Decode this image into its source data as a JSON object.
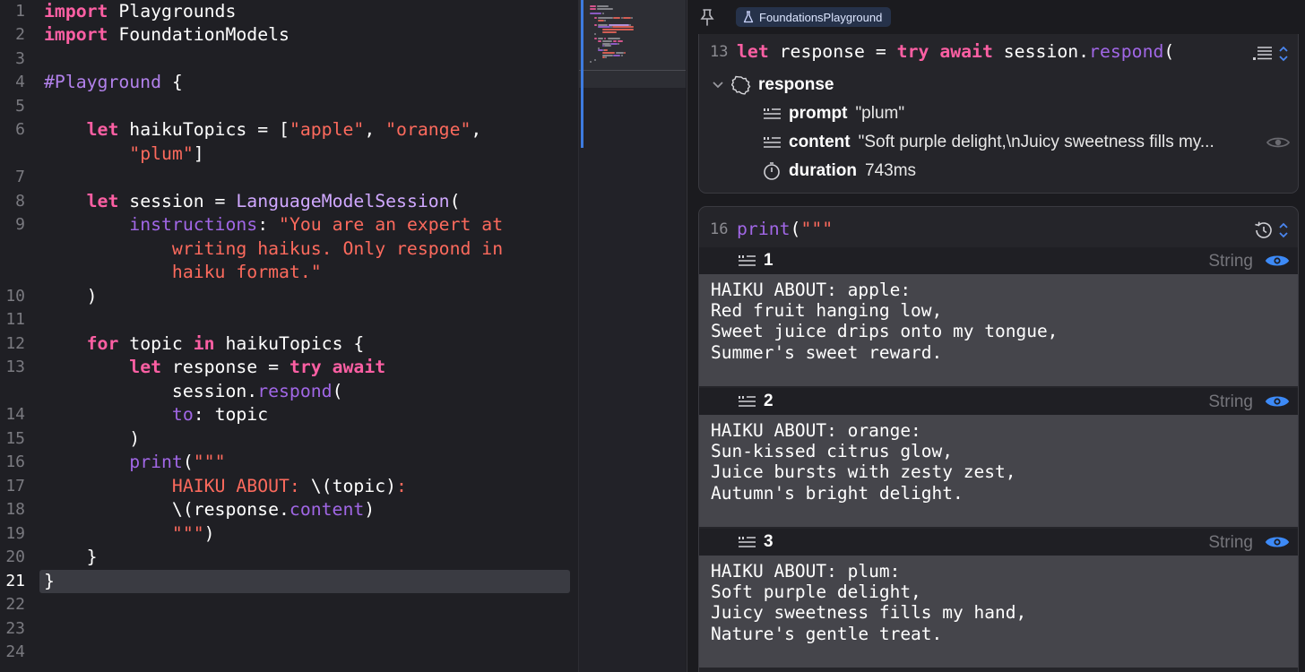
{
  "editor": {
    "lines": [
      {
        "n": "1",
        "tokens": [
          {
            "t": "import",
            "c": "kw"
          },
          {
            "t": " Playgrounds",
            "c": "pl"
          }
        ]
      },
      {
        "n": "2",
        "tokens": [
          {
            "t": "import",
            "c": "kw"
          },
          {
            "t": " FoundationModels",
            "c": "pl"
          }
        ]
      },
      {
        "n": "3",
        "tokens": []
      },
      {
        "n": "4",
        "tokens": [
          {
            "t": "#Playground",
            "c": "mac"
          },
          {
            "t": " {",
            "c": "pl"
          }
        ]
      },
      {
        "n": "5",
        "tokens": []
      },
      {
        "n": "6",
        "tokens": [
          {
            "t": "    ",
            "c": "pl"
          },
          {
            "t": "let",
            "c": "kw"
          },
          {
            "t": " haikuTopics = [",
            "c": "pl"
          },
          {
            "t": "\"apple\"",
            "c": "str"
          },
          {
            "t": ", ",
            "c": "pl"
          },
          {
            "t": "\"orange\"",
            "c": "str"
          },
          {
            "t": ",",
            "c": "pl"
          }
        ]
      },
      {
        "n": "",
        "tokens": [
          {
            "t": "        ",
            "c": "pl"
          },
          {
            "t": "\"plum\"",
            "c": "str"
          },
          {
            "t": "]",
            "c": "pl"
          }
        ]
      },
      {
        "n": "7",
        "tokens": []
      },
      {
        "n": "8",
        "tokens": [
          {
            "t": "    ",
            "c": "pl"
          },
          {
            "t": "let",
            "c": "kw"
          },
          {
            "t": " session = ",
            "c": "pl"
          },
          {
            "t": "LanguageModelSession",
            "c": "type"
          },
          {
            "t": "(",
            "c": "pl"
          }
        ]
      },
      {
        "n": "9",
        "tokens": [
          {
            "t": "        ",
            "c": "pl"
          },
          {
            "t": "instructions",
            "c": "fn"
          },
          {
            "t": ": ",
            "c": "pl"
          },
          {
            "t": "\"You are an expert at",
            "c": "str"
          }
        ]
      },
      {
        "n": "",
        "tokens": [
          {
            "t": "            ",
            "c": "pl"
          },
          {
            "t": "writing haikus. Only respond in",
            "c": "str"
          }
        ]
      },
      {
        "n": "",
        "tokens": [
          {
            "t": "            ",
            "c": "pl"
          },
          {
            "t": "haiku format.\"",
            "c": "str"
          }
        ]
      },
      {
        "n": "10",
        "tokens": [
          {
            "t": "    )",
            "c": "pl"
          }
        ]
      },
      {
        "n": "11",
        "tokens": []
      },
      {
        "n": "12",
        "tokens": [
          {
            "t": "    ",
            "c": "pl"
          },
          {
            "t": "for",
            "c": "kw"
          },
          {
            "t": " topic ",
            "c": "pl"
          },
          {
            "t": "in",
            "c": "kw"
          },
          {
            "t": " haikuTopics {",
            "c": "pl"
          }
        ]
      },
      {
        "n": "13",
        "tokens": [
          {
            "t": "        ",
            "c": "pl"
          },
          {
            "t": "let",
            "c": "kw"
          },
          {
            "t": " response = ",
            "c": "pl"
          },
          {
            "t": "try",
            "c": "kw"
          },
          {
            "t": " ",
            "c": "pl"
          },
          {
            "t": "await",
            "c": "kw"
          }
        ]
      },
      {
        "n": "",
        "tokens": [
          {
            "t": "            session.",
            "c": "pl"
          },
          {
            "t": "respond",
            "c": "fn"
          },
          {
            "t": "(",
            "c": "pl"
          }
        ]
      },
      {
        "n": "14",
        "tokens": [
          {
            "t": "            ",
            "c": "pl"
          },
          {
            "t": "to",
            "c": "fn"
          },
          {
            "t": ": topic",
            "c": "pl"
          }
        ]
      },
      {
        "n": "15",
        "tokens": [
          {
            "t": "        )",
            "c": "pl"
          }
        ]
      },
      {
        "n": "16",
        "tokens": [
          {
            "t": "        ",
            "c": "pl"
          },
          {
            "t": "print",
            "c": "fn"
          },
          {
            "t": "(",
            "c": "pl"
          },
          {
            "t": "\"\"\"",
            "c": "str"
          }
        ]
      },
      {
        "n": "17",
        "tokens": [
          {
            "t": "            ",
            "c": "pl"
          },
          {
            "t": "HAIKU ABOUT: ",
            "c": "str"
          },
          {
            "t": "\\(topic)",
            "c": "pl"
          },
          {
            "t": ":",
            "c": "str"
          }
        ]
      },
      {
        "n": "18",
        "tokens": [
          {
            "t": "            \\(response.",
            "c": "pl"
          },
          {
            "t": "content",
            "c": "fn"
          },
          {
            "t": ")",
            "c": "pl"
          }
        ]
      },
      {
        "n": "19",
        "tokens": [
          {
            "t": "            ",
            "c": "pl"
          },
          {
            "t": "\"\"\"",
            "c": "str"
          },
          {
            "t": ")",
            "c": "pl"
          }
        ]
      },
      {
        "n": "20",
        "tokens": [
          {
            "t": "    }",
            "c": "pl"
          }
        ]
      },
      {
        "n": "21",
        "tokens": [
          {
            "t": "}",
            "c": "pl"
          }
        ],
        "current": true
      },
      {
        "n": "22",
        "tokens": []
      },
      {
        "n": "23",
        "tokens": []
      },
      {
        "n": "24",
        "tokens": []
      }
    ]
  },
  "results": {
    "playground_name": "FoundationsPlayground",
    "response_card": {
      "line_number": "13",
      "expression_tokens": [
        {
          "t": "let",
          "c": "kw"
        },
        {
          "t": " response = ",
          "c": "pl"
        },
        {
          "t": "try",
          "c": "kw"
        },
        {
          "t": " ",
          "c": "pl"
        },
        {
          "t": "await",
          "c": "kw"
        },
        {
          "t": " session.",
          "c": "pl"
        },
        {
          "t": "respond",
          "c": "fn"
        },
        {
          "t": "(",
          "c": "pl"
        }
      ],
      "root_name": "response",
      "prompt_name": "prompt",
      "prompt_value": "\"plum\"",
      "content_name": "content",
      "content_value": "\"Soft purple delight,\\nJuicy sweetness fills my...",
      "duration_name": "duration",
      "duration_value": "743ms"
    },
    "print_card": {
      "line_number": "16",
      "expression_tokens": [
        {
          "t": "print",
          "c": "fn"
        },
        {
          "t": "(",
          "c": "pl"
        },
        {
          "t": "\"\"\"",
          "c": "str"
        }
      ],
      "outputs": [
        {
          "index": "1",
          "kind": "String",
          "lines": [
            "HAIKU ABOUT: apple:",
            "Red fruit hanging low,",
            "Sweet juice drips onto my tongue,",
            "Summer's sweet reward."
          ]
        },
        {
          "index": "2",
          "kind": "String",
          "lines": [
            "HAIKU ABOUT: orange:",
            "Sun-kissed citrus glow,",
            "Juice bursts with zesty zest,",
            "Autumn's bright delight."
          ]
        },
        {
          "index": "3",
          "kind": "String",
          "lines": [
            "HAIKU ABOUT: plum:",
            "Soft purple delight,",
            "Juicy sweetness fills my hand,",
            "Nature's gentle treat."
          ]
        }
      ]
    }
  },
  "colors": {
    "keyword": "#fc5fa3",
    "string": "#fc6a5d",
    "type": "#d0a8ff",
    "function": "#a167e6",
    "accent_blue": "#3d7be0"
  }
}
